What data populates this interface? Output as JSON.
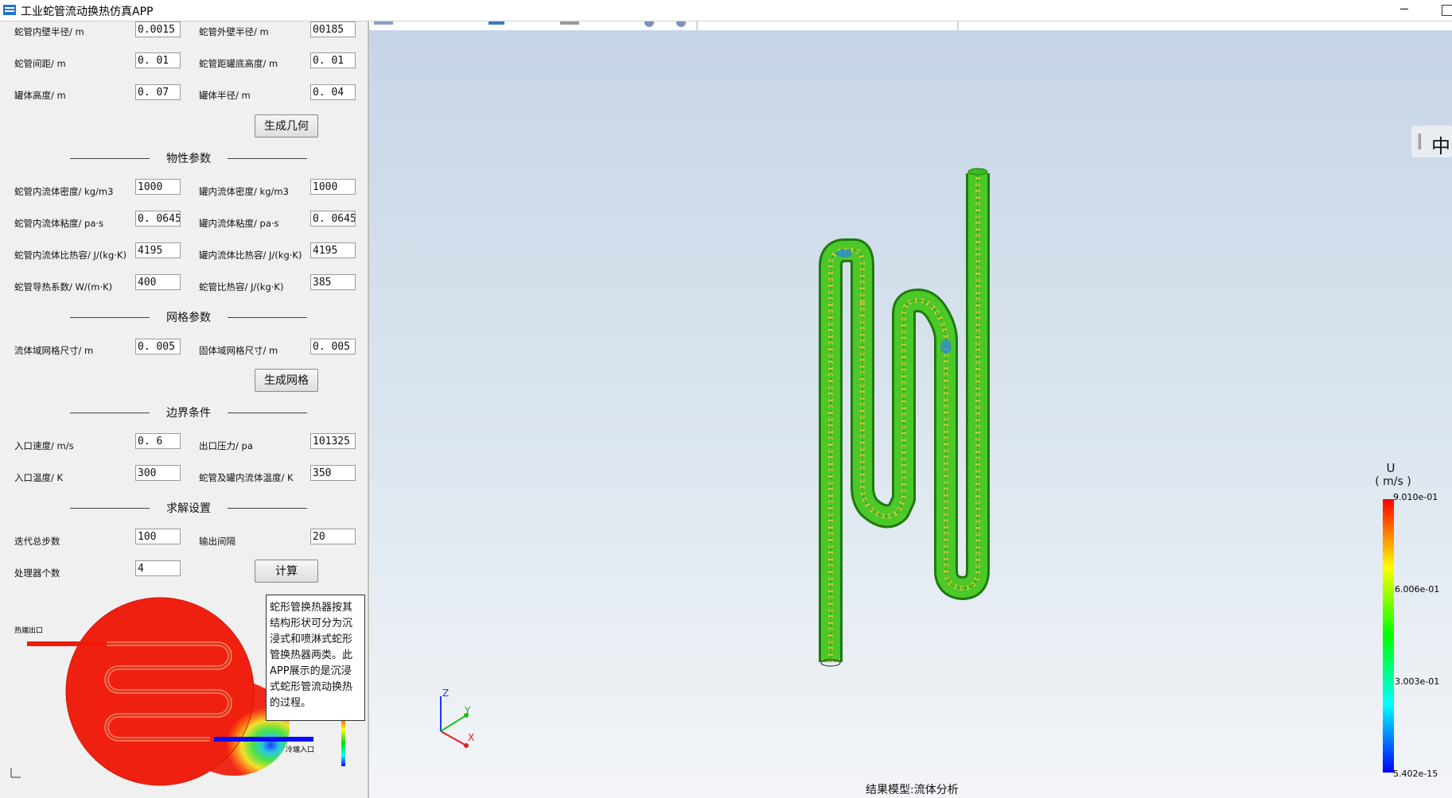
{
  "window": {
    "title": "工业蛇管流动换热仿真APP",
    "minimize": "─"
  },
  "geometry": {
    "inner_radius_label": "蛇管内壁半径/ m",
    "inner_radius": "0.0015",
    "outer_radius_label": "蛇管外壁半径/ m",
    "outer_radius": "00185",
    "spacing_label": "蛇管间距/ m",
    "spacing": "0. 01",
    "bottom_height_label": "蛇管距罐底高度/ m",
    "bottom_height": "0. 01",
    "tank_height_label": "罐体高度/ m",
    "tank_height": "0. 07",
    "tank_radius_label": "罐体半径/ m",
    "tank_radius": "0. 04",
    "generate_button": "生成几何"
  },
  "properties": {
    "section": "物性参数",
    "coil_density_label": "蛇管内流体密度/ kg/m3",
    "coil_density": "1000",
    "tank_density_label": "罐内流体密度/ kg/m3",
    "tank_density": "1000",
    "coil_viscosity_label": "蛇管内流体粘度/ pa·s",
    "coil_viscosity": "0. 0645",
    "tank_viscosity_label": "罐内流体粘度/ pa·s",
    "tank_viscosity": "0. 0645",
    "coil_cp_label": "蛇管内流体比热容/ J/(kg·K)",
    "coil_cp": "4195",
    "tank_cp_label": "罐内流体比热容/ J/(kg·K)",
    "tank_cp": "4195",
    "coil_k_label": "蛇管导热系数/ W/(m·K)",
    "coil_k": "400",
    "coil_solid_cp_label": "蛇管比热容/ J/(kg·K)",
    "coil_solid_cp": "385"
  },
  "mesh": {
    "section": "网格参数",
    "fluid_size_label": "流体域网格尺寸/ m",
    "fluid_size": "0. 005",
    "solid_size_label": "固体域网格尺寸/ m",
    "solid_size": "0. 005",
    "generate_button": "生成网格"
  },
  "boundary": {
    "section": "边界条件",
    "inlet_velocity_label": "入口速度/ m/s",
    "inlet_velocity": "0. 6",
    "outlet_pressure_label": "出口压力/ pa",
    "outlet_pressure": "101325",
    "inlet_temp_label": "入口温度/ K",
    "inlet_temp": "300",
    "coil_temp_label": "蛇管及罐内流体温度/ K",
    "coil_temp": "350"
  },
  "solver": {
    "section": "求解设置",
    "iterations_label": "迭代总步数",
    "iterations": "100",
    "output_interval_label": "输出间隔",
    "output_interval": "20",
    "processors_label": "处理器个数",
    "processors": "4",
    "compute_button": "计算"
  },
  "preview": {
    "hot_outlet_label": "热端出口",
    "cold_inlet_label": "冷端入口",
    "note": "蛇形管换热器按其结构形状可分为沉浸式和喷淋式蛇形管换热器两类。此APP展示的是沉浸式蛇形管流动换热的过程。"
  },
  "viewport": {
    "language_button": "中",
    "legend_title_u": "U",
    "legend_title_unit": "( m/s )",
    "legend_ticks": [
      "9.010e-01",
      "6.006e-01",
      "3.003e-01",
      "5.402e-15"
    ],
    "result_label": "结果模型:流体分析",
    "axis_x": "X",
    "axis_y": "Y",
    "axis_z": "Z"
  },
  "colors": {
    "legend_top": "#ff0000",
    "legend_bottom": "#0000ff",
    "tube_main": "#3cc81e"
  }
}
